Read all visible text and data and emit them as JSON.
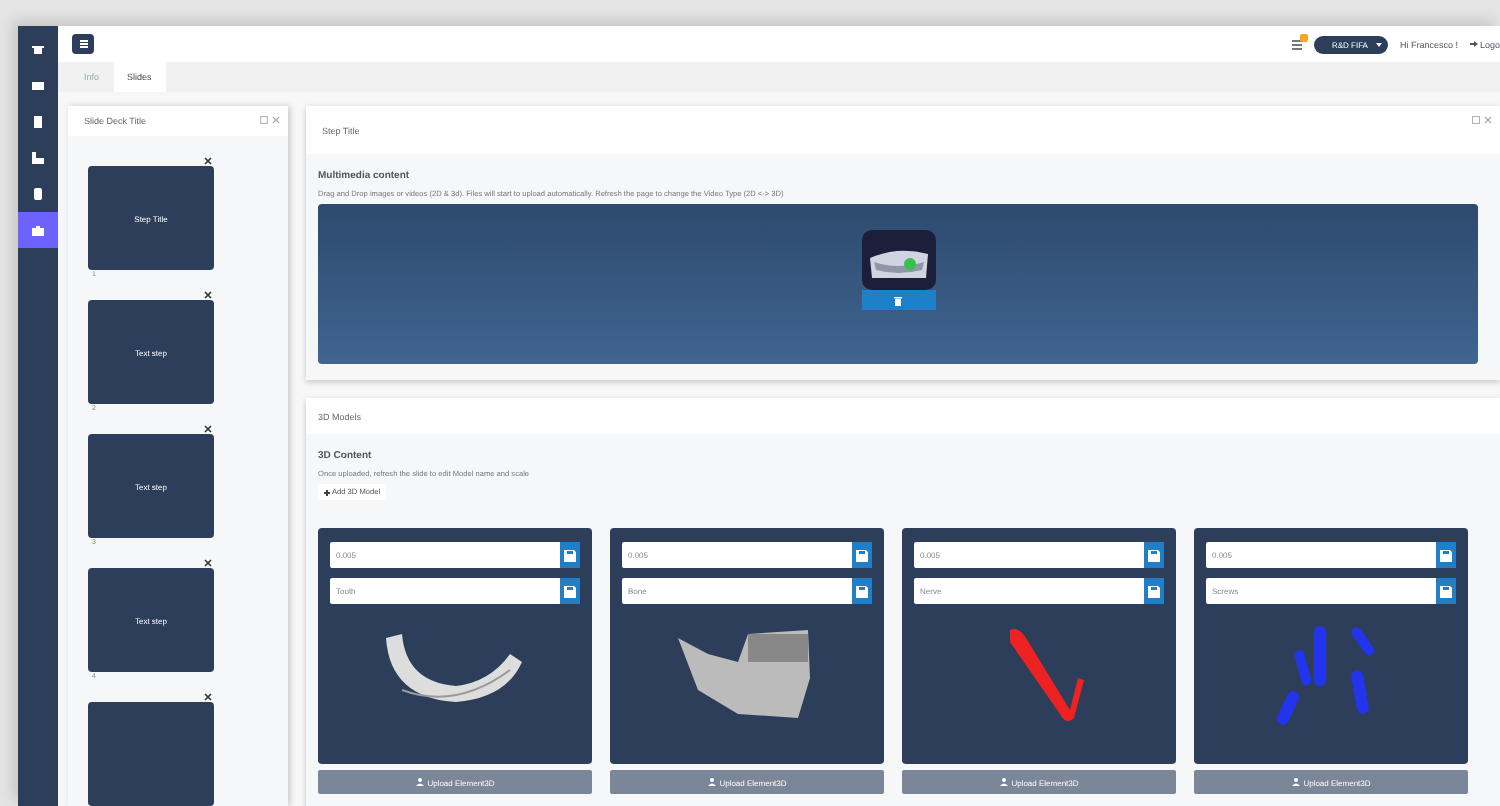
{
  "sidebar": {
    "items": [
      {
        "selected": false
      },
      {
        "selected": false
      },
      {
        "selected": false
      },
      {
        "selected": false
      },
      {
        "selected": false
      },
      {
        "selected": true
      }
    ]
  },
  "topbar": {
    "notification_badge": true,
    "project": "R&D FIFA",
    "greeting": "Hi Francesco !",
    "logout": "Logo"
  },
  "tabs": [
    {
      "label": "Info",
      "selected": false
    },
    {
      "label": "Slides",
      "selected": true
    }
  ],
  "slide_deck": {
    "title": "Slide Deck Title",
    "slides": [
      {
        "kind": "slide",
        "title": "Step Title",
        "number": "1"
      },
      {
        "kind": "slide",
        "title": "Text step",
        "number": "2"
      },
      {
        "kind": "slide",
        "title": "Text step",
        "number": "3"
      },
      {
        "kind": "slide",
        "title": "Text step",
        "number": "4"
      },
      {
        "kind": "slide"
      }
    ]
  },
  "step": {
    "title": "Step Title",
    "multimedia": {
      "heading": "Multimedia content",
      "description": "Drag and Drop images or videos (2D & 3d). Files will start to upload automatically. Refresh the page to change the Video Type (2D <-> 3D)"
    }
  },
  "models": {
    "title": "3D Models",
    "heading": "3D Content",
    "description": "Once uploaded, refresh the slide to edit Model name and scale",
    "add_button": "Add 3D Model",
    "cards": [
      {
        "scale": "0.005",
        "name": "Tooth",
        "kind": "tooth",
        "upload": "Upload Element3D"
      },
      {
        "scale": "0.005",
        "name": "Bone",
        "kind": "bone",
        "upload": "Upload Element3D"
      },
      {
        "scale": "0.005",
        "name": "Nerve",
        "kind": "nerve",
        "upload": "Upload Element3D"
      },
      {
        "scale": "0.005",
        "name": "Screws",
        "kind": "screws",
        "upload": "Upload Element3D"
      }
    ]
  }
}
